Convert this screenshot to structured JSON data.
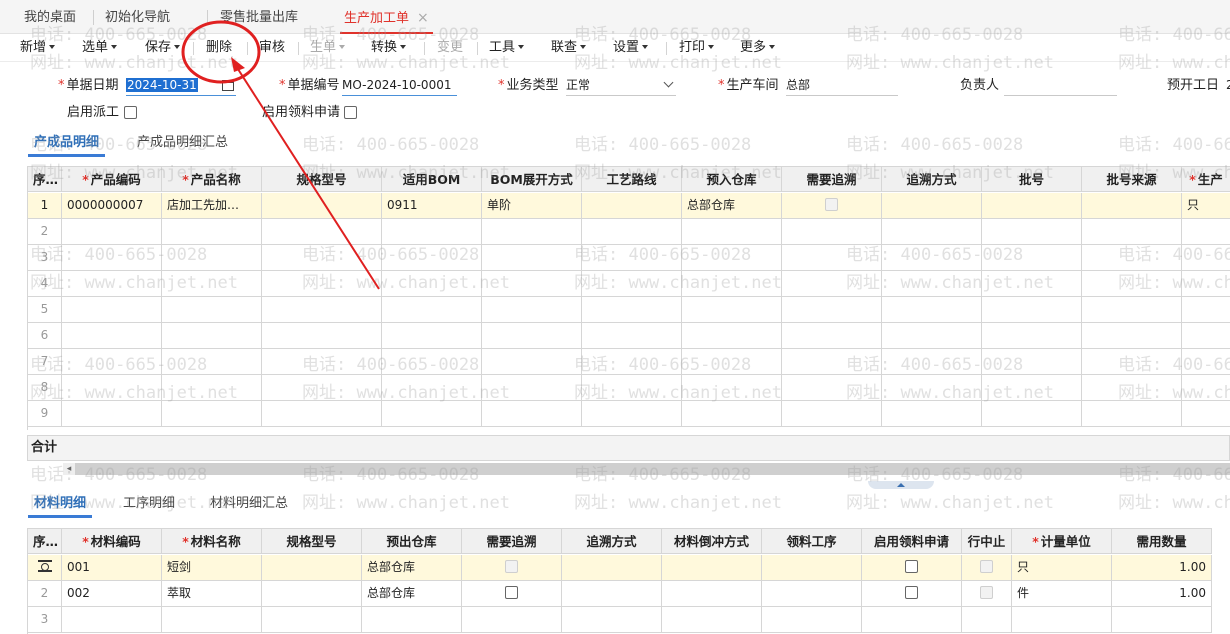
{
  "tabs": [
    {
      "label": "我的桌面",
      "active": false
    },
    {
      "label": "初始化导航",
      "active": false
    },
    {
      "label": "零售批量出库",
      "active": false
    },
    {
      "label": "生产加工单",
      "active": true
    }
  ],
  "tab_close": "×",
  "toolbar": {
    "new": "新增",
    "select": "选单",
    "save": "保存",
    "delete": "删除",
    "audit": "审核",
    "gen": "生单",
    "convert": "转换",
    "change": "变更",
    "tools": "工具",
    "link": "联查",
    "settings": "设置",
    "print": "打印",
    "more": "更多"
  },
  "form": {
    "date_label": "单据日期",
    "date_value": "2024-10-31",
    "code_label": "单据编号",
    "code_value": "MO-2024-10-0001",
    "biz_label": "业务类型",
    "biz_value": "正常",
    "workshop_label": "生产车间",
    "workshop_value": "总部",
    "owner_label": "负责人",
    "owner_value": "",
    "start_label": "预开工日",
    "start_value": "2",
    "dispatch_label": "启用派工",
    "apply_label": "启用领料申请"
  },
  "product_tabs": [
    "产成品明细",
    "产成品明细汇总"
  ],
  "product_grid": {
    "headers": [
      "序号",
      "产品编码",
      "产品名称",
      "规格型号",
      "适用BOM",
      "BOM展开方式",
      "工艺路线",
      "预入仓库",
      "需要追溯",
      "追溯方式",
      "批号",
      "批号来源",
      "生产"
    ],
    "required": [
      false,
      true,
      true,
      false,
      false,
      false,
      false,
      false,
      false,
      false,
      false,
      false,
      true
    ],
    "rows": [
      [
        "1",
        "0000000007",
        "店加工先加…",
        "",
        "0911",
        "单阶",
        "",
        "总部仓库",
        "",
        "",
        "",
        "",
        "只"
      ],
      [
        "2"
      ],
      [
        "3"
      ],
      [
        "4"
      ],
      [
        "5"
      ],
      [
        "6"
      ],
      [
        "7"
      ],
      [
        "8"
      ],
      [
        "9"
      ]
    ],
    "total_label": "合计"
  },
  "material_tabs": [
    "材料明细",
    "工序明细",
    "材料明细汇总"
  ],
  "material_grid": {
    "headers": [
      "序号",
      "材料编码",
      "材料名称",
      "规格型号",
      "预出仓库",
      "需要追溯",
      "追溯方式",
      "材料倒冲方式",
      "领料工序",
      "启用领料申请",
      "行中止",
      "计量单位",
      "需用数量"
    ],
    "required": [
      false,
      true,
      true,
      false,
      false,
      false,
      false,
      false,
      false,
      false,
      false,
      true,
      false
    ],
    "rows": [
      [
        "",
        "001",
        "短剑",
        "",
        "总部仓库",
        "",
        "",
        "",
        "",
        "",
        "",
        "只",
        "1.00"
      ],
      [
        "2",
        "002",
        "萃取",
        "",
        "总部仓库",
        "",
        "",
        "",
        "",
        "",
        "",
        "件",
        "1.00"
      ],
      [
        "3"
      ]
    ]
  },
  "watermark": {
    "phone": "电话: 400-665-0028",
    "site": "网址: www.chanjet.net"
  },
  "colors": {
    "accent": "#e0322b",
    "blue": "#3a7bd5",
    "highlight_row": "#fff9dc",
    "annotation": "#e02020"
  }
}
